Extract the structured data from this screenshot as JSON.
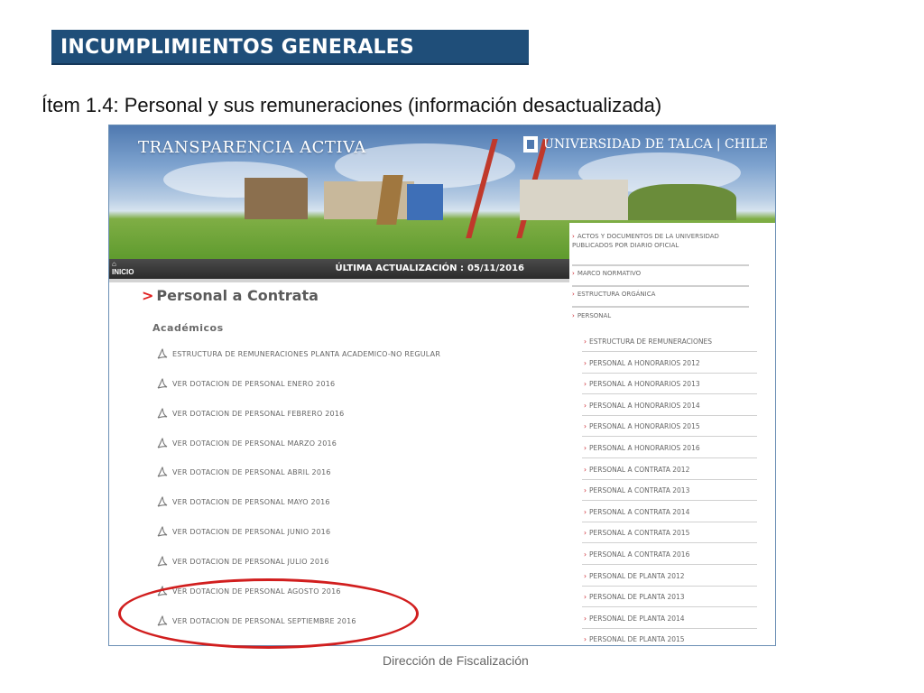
{
  "slide": {
    "title": "INCUMPLIMIENTOS GENERALES",
    "subtitle": "Ítem 1.4: Personal y sus remuneraciones (información desactualizada)",
    "footer": "Dirección de Fiscalización"
  },
  "site": {
    "banner_title": "TRANSPARENCIA ACTIVA",
    "university": "UNIVERSIDAD DE TALCA | CHILE",
    "home_label": "INICIO",
    "update_label": "ÚLTIMA ACTUALIZACIÓN :",
    "update_date": "05/11/2016",
    "page_heading": "Personal a Contrata",
    "section_heading": "Académicos",
    "documents": [
      "ESTRUCTURA DE REMUNERACIONES PLANTA ACADEMICO-NO REGULAR",
      "VER DOTACION DE PERSONAL ENERO 2016",
      "VER DOTACION DE PERSONAL FEBRERO 2016",
      "VER DOTACION DE PERSONAL MARZO 2016",
      "VER DOTACION DE PERSONAL ABRIL 2016",
      "VER DOTACION DE PERSONAL MAYO 2016",
      "VER DOTACION DE PERSONAL JUNIO 2016",
      "VER DOTACION DE PERSONAL JULIO 2016",
      "VER DOTACION DE PERSONAL AGOSTO 2016",
      "VER DOTACION DE PERSONAL SEPTIEMBRE 2016"
    ],
    "menu_top": [
      "ACTOS Y DOCUMENTOS DE LA UNIVERSIDAD PUBLICADOS POR DIARIO OFICIAL",
      "MARCO NORMATIVO",
      "ESTRUCTURA ORGÁNICA",
      "PERSONAL"
    ],
    "menu_sub": [
      "ESTRUCTURA DE REMUNERACIONES",
      "PERSONAL A HONORARIOS 2012",
      "PERSONAL A HONORARIOS 2013",
      "PERSONAL A HONORARIOS 2014",
      "PERSONAL A HONORARIOS 2015",
      "PERSONAL A HONORARIOS 2016",
      "PERSONAL A CONTRATA 2012",
      "PERSONAL A CONTRATA 2013",
      "PERSONAL A CONTRATA 2014",
      "PERSONAL A CONTRATA 2015",
      "PERSONAL A CONTRATA 2016",
      "PERSONAL DE PLANTA 2012",
      "PERSONAL DE PLANTA 2013",
      "PERSONAL DE PLANTA 2014",
      "PERSONAL DE PLANTA 2015"
    ]
  },
  "colors": {
    "title_bg": "#1f4e79",
    "highlight": "#d11e1e",
    "menu_arrow": "#c8141e"
  }
}
